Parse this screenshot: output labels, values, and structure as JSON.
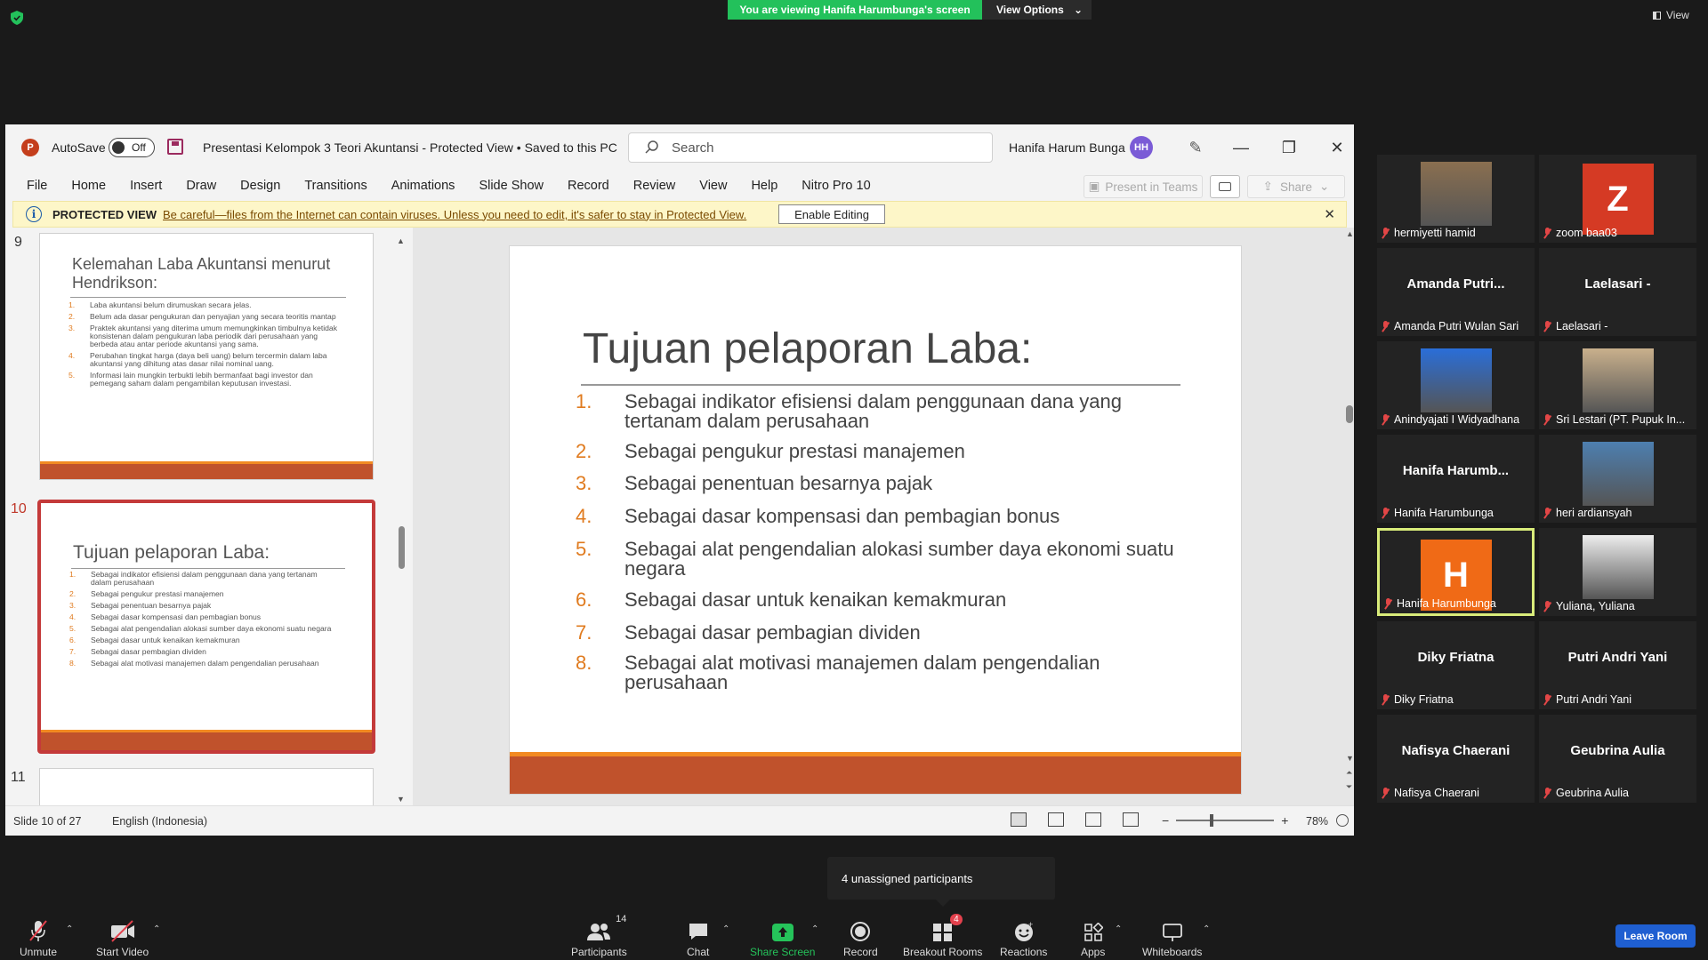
{
  "zoom": {
    "viewing_banner": "You are viewing Hanifa Harumbunga's screen",
    "view_options": "View Options",
    "view_top_right": "View"
  },
  "ppt": {
    "autosave_label": "AutoSave",
    "autosave_state": "Off",
    "doc_title": "Presentasi Kelompok 3 Teori Akuntansi  -  Protected View  •  Saved to this PC",
    "search_placeholder": "Search",
    "user_name": "Hanifa Harum Bunga",
    "user_initials": "HH",
    "menu": [
      "File",
      "Home",
      "Insert",
      "Draw",
      "Design",
      "Transitions",
      "Animations",
      "Slide Show",
      "Record",
      "Review",
      "View",
      "Help",
      "Nitro Pro 10"
    ],
    "present_in_teams": "Present in Teams",
    "share": "Share",
    "protected_label": "PROTECTED VIEW",
    "protected_msg": "Be careful—files from the Internet can contain viruses. Unless you need to edit, it's safer to stay in Protected View.",
    "enable_editing": "Enable Editing",
    "thumb9": {
      "num": "9",
      "title": "Kelemahan Laba Akuntansi menurut Hendrikson:",
      "items": [
        "Laba akuntansi belum dirumuskan secara jelas.",
        "Belum ada dasar pengukuran dan penyajian yang secara teoritis mantap",
        "Praktek akuntansi yang diterima umum memungkinkan timbulnya ketidak konsistenan dalam pengukuran laba periodik dari perusahaan yang berbeda atau antar periode akuntansi yang sama.",
        "Perubahan tingkat harga (daya beli uang) belum tercermin dalam laba akuntansi yang dihitung atas dasar nilai nominal uang.",
        "Informasi lain mungkin terbukti lebih bermanfaat bagi investor dan pemegang saham dalam pengambilan keputusan investasi."
      ]
    },
    "thumb10_num": "10",
    "thumb11_num": "11",
    "slide": {
      "title": "Tujuan pelaporan Laba:",
      "items": [
        "Sebagai indikator efisiensi dalam penggunaan dana yang tertanam dalam perusahaan",
        "Sebagai pengukur prestasi manajemen",
        "Sebagai penentuan besarnya pajak",
        "Sebagai dasar kompensasi dan pembagian bonus",
        "Sebagai alat pengendalian alokasi sumber daya ekonomi suatu negara",
        "Sebagai dasar untuk kenaikan kemakmuran",
        "Sebagai dasar pembagian dividen",
        "Sebagai alat motivasi manajemen dalam pengendalian perusahaan"
      ]
    },
    "status_slide": "Slide 10 of 27",
    "status_lang": "English (Indonesia)",
    "zoom_pct": "78%"
  },
  "participants": [
    {
      "big": "",
      "label": "hermiyetti hamid",
      "kind": "photo",
      "color": "#8a6f50"
    },
    {
      "big": "Z",
      "label": "zoom baa03",
      "kind": "avatar",
      "color": "#d53a24"
    },
    {
      "big": "Amanda  Putri...",
      "label": "Amanda Putri Wulan Sari",
      "kind": "name"
    },
    {
      "big": "Laelasari -",
      "label": "Laelasari -",
      "kind": "name"
    },
    {
      "big": "",
      "label": "Anindyajati I Widyadhana",
      "kind": "photo",
      "color": "#2a6ed8"
    },
    {
      "big": "",
      "label": "Sri Lestari (PT. Pupuk In...",
      "kind": "photo",
      "color": "#c9b08c"
    },
    {
      "big": "Hanifa  Harumb...",
      "label": "Hanifa Harumbunga",
      "kind": "name"
    },
    {
      "big": "",
      "label": "heri ardiansyah",
      "kind": "photo",
      "color": "#4d7fb0"
    },
    {
      "big": "H",
      "label": "Hanifa Harumbunga",
      "kind": "avatar",
      "color": "#f06a16"
    },
    {
      "big": "",
      "label": "Yuliana, Yuliana",
      "kind": "photo",
      "color": "#ededed"
    },
    {
      "big": "Diky Friatna",
      "label": "Diky Friatna",
      "kind": "name"
    },
    {
      "big": "Putri Andri Yani",
      "label": "Putri Andri Yani",
      "kind": "name"
    },
    {
      "big": "Nafisya Chaerani",
      "label": "Nafisya Chaerani",
      "kind": "name"
    },
    {
      "big": "Geubrina Aulia",
      "label": "Geubrina Aulia",
      "kind": "name"
    }
  ],
  "unassigned": "4 unassigned participants",
  "toolbar": {
    "unmute": "Unmute",
    "start_video": "Start Video",
    "participants": "Participants",
    "participants_count": "14",
    "chat": "Chat",
    "share_screen": "Share Screen",
    "record": "Record",
    "breakout_rooms": "Breakout Rooms",
    "breakout_badge": "4",
    "reactions": "Reactions",
    "apps": "Apps",
    "whiteboards": "Whiteboards",
    "leave_room": "Leave Room"
  }
}
